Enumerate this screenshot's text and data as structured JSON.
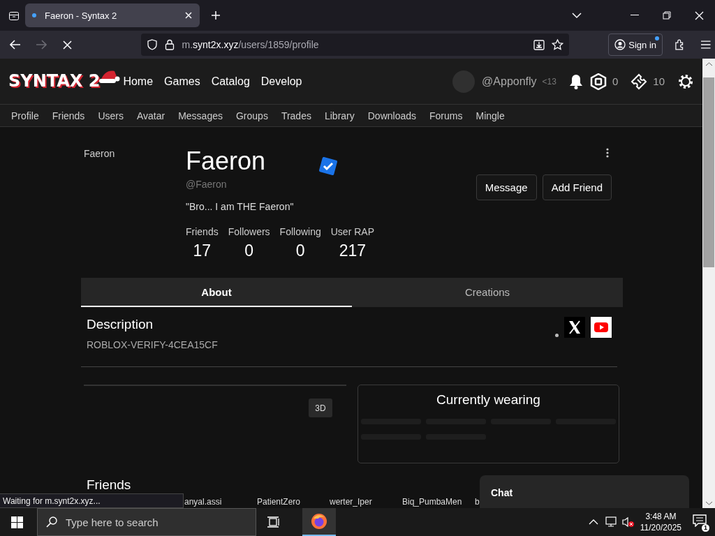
{
  "browser": {
    "tab_title": "Faeron - Syntax 2",
    "loading": true,
    "url_host": "m.synt2x.xyz",
    "url_path": "/users/1859/profile",
    "sign_in": "Sign in",
    "status": "Waiting for m.synt2x.xyz..."
  },
  "header": {
    "logo": "SYNTAX 2",
    "nav": [
      "Home",
      "Games",
      "Catalog",
      "Develop"
    ],
    "username": "@Apponfly",
    "age": "<13",
    "robux": "0",
    "tickets": "10"
  },
  "subnav": [
    "Profile",
    "Friends",
    "Users",
    "Avatar",
    "Messages",
    "Groups",
    "Trades",
    "Library",
    "Downloads",
    "Forums",
    "Mingle"
  ],
  "profile": {
    "sidebar_name": "Faeron",
    "display_name": "Faeron",
    "verified": true,
    "username": "@Faeron",
    "status": "\"Bro... I am THE Faeron\"",
    "stats": [
      {
        "label": "Friends",
        "value": "17"
      },
      {
        "label": "Followers",
        "value": "0"
      },
      {
        "label": "Following",
        "value": "0"
      },
      {
        "label": "User RAP",
        "value": "217"
      }
    ],
    "actions": [
      "Message",
      "Add Friend"
    ]
  },
  "tabs": [
    {
      "label": "About",
      "selected": true
    },
    {
      "label": "Creations",
      "selected": false
    }
  ],
  "description": {
    "heading": "Description",
    "text": "ROBLOX-VERIFY-4CEA15CF"
  },
  "socials": [
    {
      "kind": "x"
    },
    {
      "kind": "youtube"
    }
  ],
  "avatar": {
    "view_toggle": "3D"
  },
  "wearing": {
    "title": "Currently wearing",
    "loading": true
  },
  "friends": {
    "heading": "Friends",
    "names": [
      "anyal.assi",
      "PatientZero",
      "werter_Iper",
      "Biq_PumbaMen",
      "b"
    ]
  },
  "chat": {
    "title": "Chat"
  },
  "taskbar": {
    "search_placeholder": "Type here to search",
    "time": "3:48 AM",
    "date": "11/20/2025",
    "notifications": "1"
  }
}
